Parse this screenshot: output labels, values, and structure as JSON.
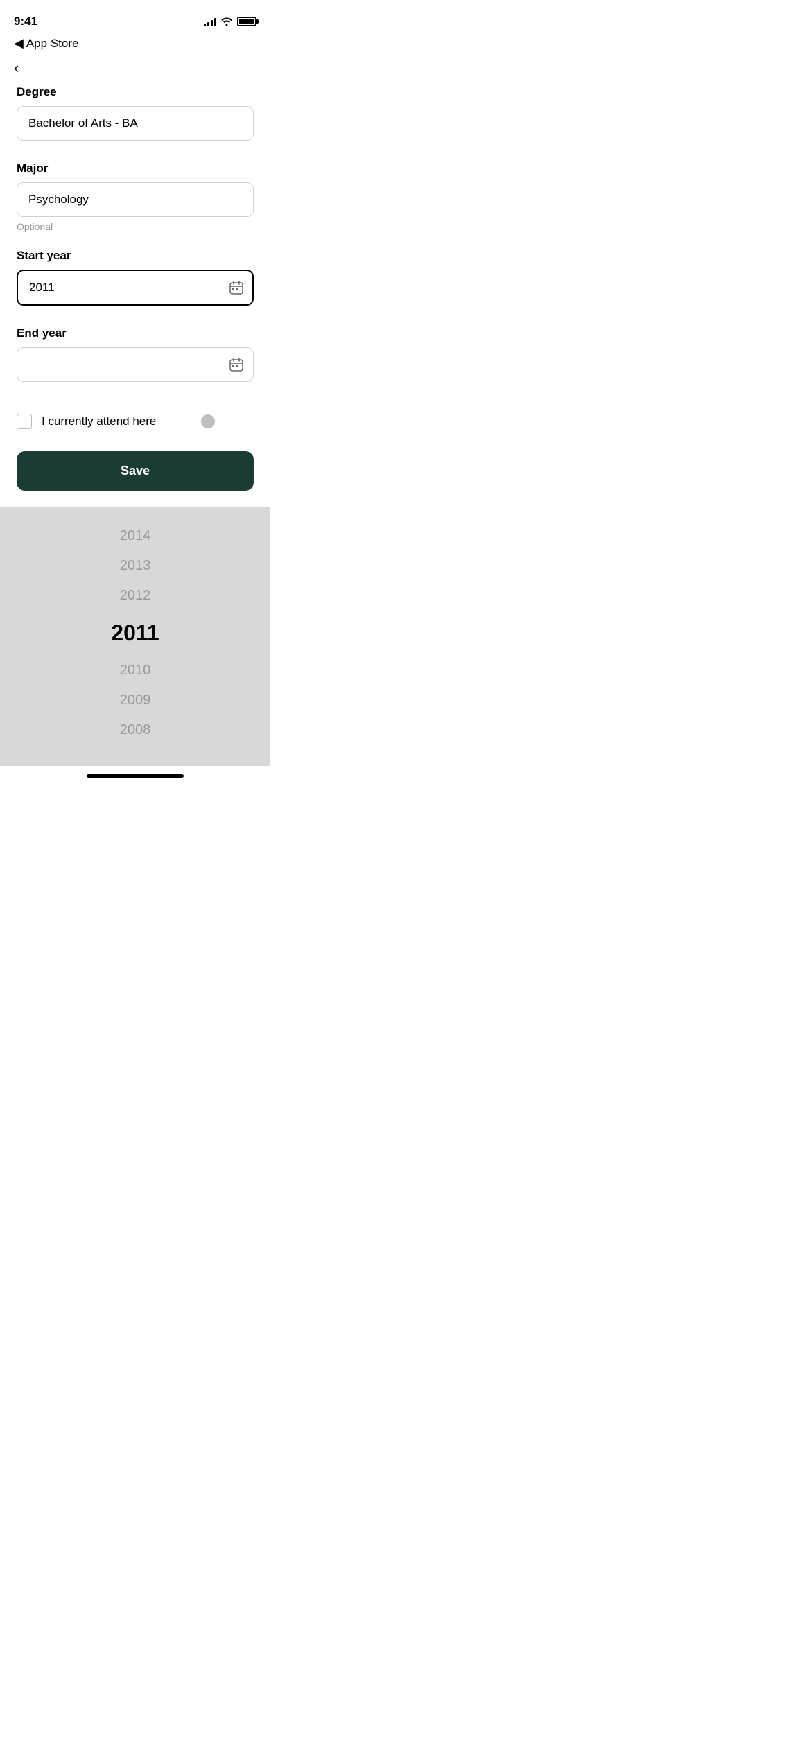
{
  "statusBar": {
    "time": "9:41",
    "appStoreLabel": "App Store"
  },
  "form": {
    "degreeLabel": "Degree",
    "degreeValue": "Bachelor of Arts - BA",
    "majorLabel": "Major",
    "majorValue": "Psychology",
    "majorHint": "Optional",
    "startYearLabel": "Start year",
    "startYearValue": "2011",
    "endYearLabel": "End year",
    "endYearValue": "",
    "checkboxLabel": "I currently attend here",
    "saveButton": "Save"
  },
  "yearPicker": {
    "years": [
      "2014",
      "2013",
      "2012",
      "2011",
      "2010",
      "2009",
      "2008"
    ],
    "selectedYear": "2011"
  }
}
